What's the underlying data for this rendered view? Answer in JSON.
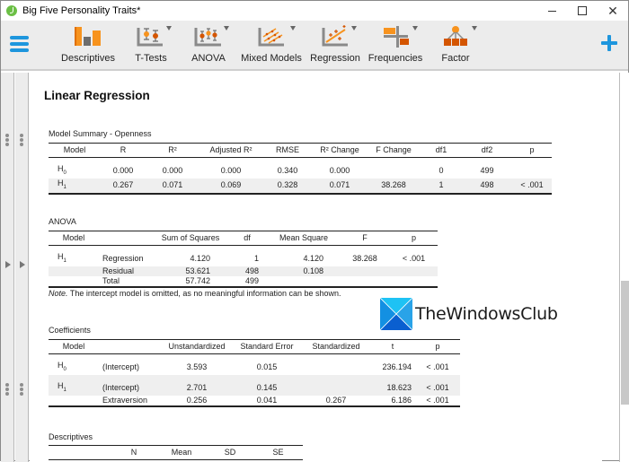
{
  "window": {
    "title": "Big Five Personality Traits*",
    "controls": {
      "minimize": "minimize",
      "maximize": "maximize",
      "close": "✕"
    }
  },
  "ribbon": {
    "items": [
      {
        "label": "Descriptives",
        "icon": "descriptives-bar-chart-icon",
        "has_dropdown": false
      },
      {
        "label": "T-Tests",
        "icon": "t-tests-icon",
        "has_dropdown": true
      },
      {
        "label": "ANOVA",
        "icon": "anova-icon",
        "has_dropdown": true
      },
      {
        "label": "Mixed Models",
        "icon": "mixed-models-icon",
        "has_dropdown": true
      },
      {
        "label": "Regression",
        "icon": "regression-icon",
        "has_dropdown": true
      },
      {
        "label": "Frequencies",
        "icon": "frequencies-icon",
        "has_dropdown": true
      },
      {
        "label": "Factor",
        "icon": "factor-icon",
        "has_dropdown": true
      }
    ],
    "colors": {
      "accent_blue": "#1e96dd",
      "orange": "#f7931e",
      "dark_orange": "#d45500",
      "gray": "#7f7f7f"
    }
  },
  "results": {
    "title": "Linear Regression",
    "model_summary": {
      "title": "Model Summary - Openness",
      "headers": [
        "Model",
        "R",
        "R²",
        "Adjusted R²",
        "RMSE",
        "R² Change",
        "F Change",
        "df1",
        "df2",
        "p"
      ],
      "rows": [
        {
          "model": "H",
          "sub": "0",
          "cells": [
            "0.000",
            "0.000",
            "0.000",
            "0.340",
            "0.000",
            "",
            "0",
            "499",
            ""
          ]
        },
        {
          "model": "H",
          "sub": "1",
          "cells": [
            "0.267",
            "0.071",
            "0.069",
            "0.328",
            "0.071",
            "38.268",
            "1",
            "498",
            "< .001"
          ]
        }
      ]
    },
    "anova": {
      "title": "ANOVA",
      "headers": [
        "Model",
        "",
        "Sum of Squares",
        "df",
        "Mean Square",
        "F",
        "p"
      ],
      "rows": [
        {
          "model": "H",
          "sub": "1",
          "cells": [
            "Regression",
            "4.120",
            "1",
            "4.120",
            "38.268",
            "< .001"
          ]
        },
        {
          "model": "",
          "sub": "",
          "cells": [
            "Residual",
            "53.621",
            "498",
            "0.108",
            "",
            ""
          ]
        },
        {
          "model": "",
          "sub": "",
          "cells": [
            "Total",
            "57.742",
            "499",
            "",
            "",
            ""
          ]
        }
      ],
      "note_label": "Note.",
      "note_text": " The intercept model is omitted, as no meaningful information can be shown."
    },
    "coefficients": {
      "title": "Coefficients",
      "headers": [
        "Model",
        "",
        "Unstandardized",
        "Standard Error",
        "Standardized",
        "t",
        "p"
      ],
      "rows": [
        {
          "model": "H",
          "sub": "0",
          "cells": [
            "(Intercept)",
            "3.593",
            "0.015",
            "",
            "236.194",
            "< .001"
          ]
        },
        {
          "model": "H",
          "sub": "1",
          "cells": [
            "(Intercept)",
            "2.701",
            "0.145",
            "",
            "18.623",
            "< .001"
          ]
        },
        {
          "model": "",
          "sub": "",
          "cells": [
            "Extraversion",
            "0.256",
            "0.041",
            "0.267",
            "6.186",
            "< .001"
          ]
        }
      ]
    },
    "descriptives": {
      "title": "Descriptives",
      "headers": [
        "",
        "N",
        "Mean",
        "SD",
        "SE"
      ]
    }
  },
  "watermark": {
    "text": "TheWindowsClub"
  },
  "scrollbar": {
    "position_fraction": 0.53
  }
}
